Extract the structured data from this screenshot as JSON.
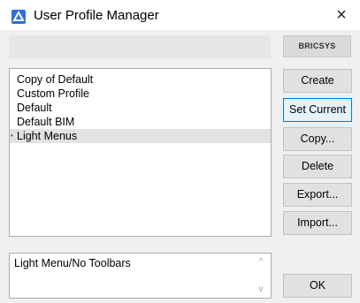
{
  "window": {
    "title": "User Profile Manager",
    "close_glyph": "×",
    "icon": "app-icon",
    "accent_color": "#2c6fe0"
  },
  "logo": {
    "text": "BRICSYS"
  },
  "profiles": {
    "items": [
      {
        "label": "Copy of Default"
      },
      {
        "label": "Custom Profile"
      },
      {
        "label": "Default"
      },
      {
        "label": "Default BIM"
      },
      {
        "label": "Light Menus",
        "current_marker": "•",
        "selected": true
      }
    ]
  },
  "buttons": {
    "create": "Create",
    "set_current": "Set Current",
    "copy": "Copy...",
    "delete": "Delete",
    "export": "Export...",
    "import": "Import...",
    "ok": "OK"
  },
  "description": {
    "text": "Light Menu/No Toolbars",
    "scroll_up_glyph": "^",
    "scroll_down_glyph": "v"
  }
}
